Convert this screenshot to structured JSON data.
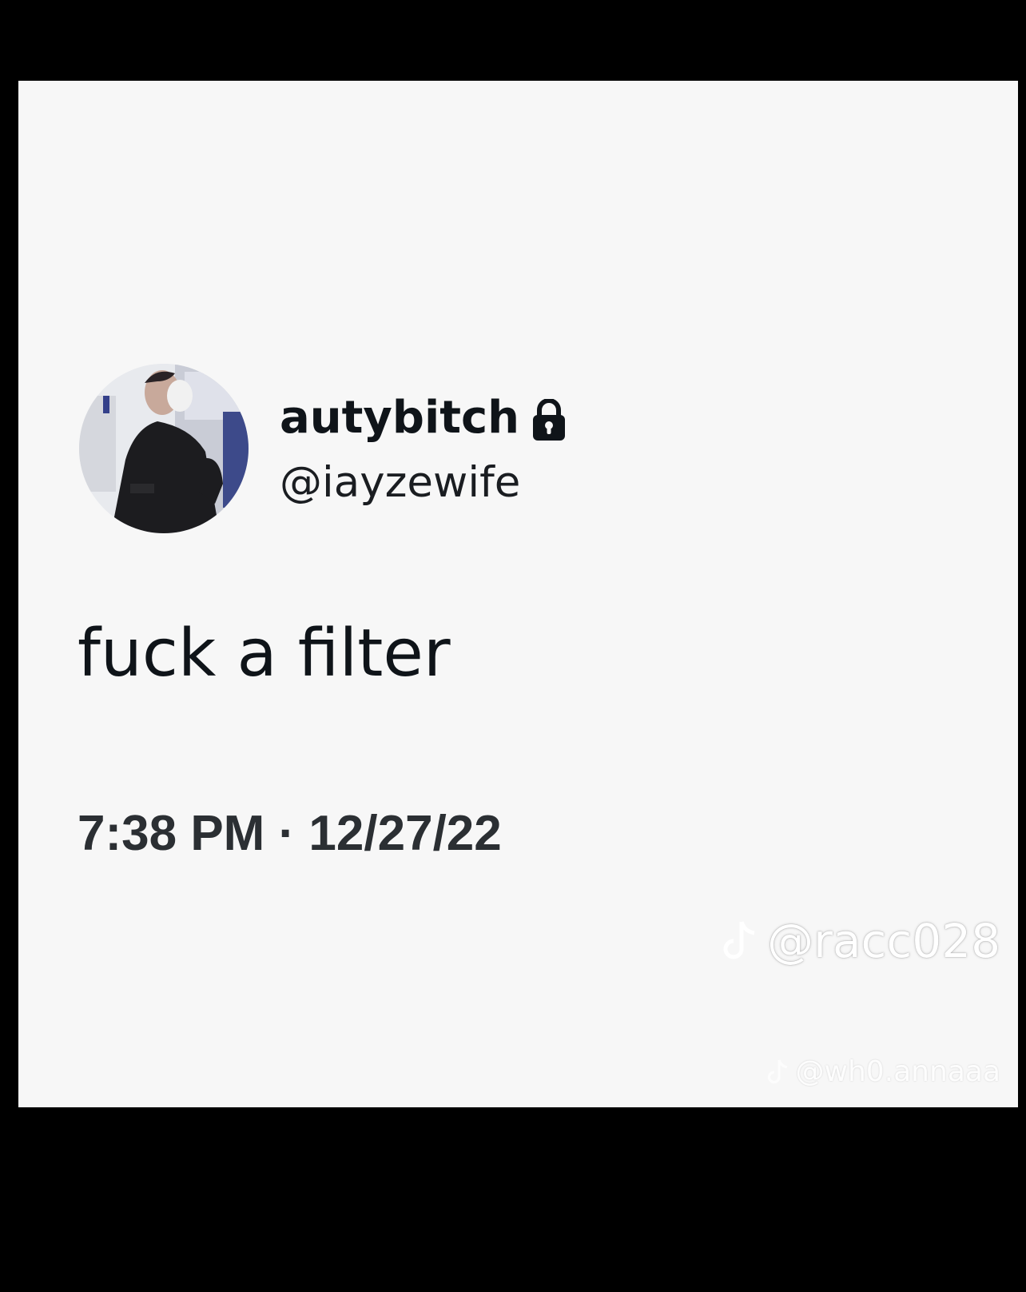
{
  "tweet": {
    "display_name": "autybitch",
    "protected_icon": "lock-icon",
    "handle": "@iayzewife",
    "avatar_icon": "profile-photo",
    "text": "fuck a filter",
    "timestamp": "7:38 PM · 12/27/22"
  },
  "watermarks": [
    {
      "icon": "tiktok-icon",
      "text": "@racc028"
    },
    {
      "icon": "tiktok-icon",
      "text": "@wh0.annaaa"
    }
  ],
  "colors": {
    "background": "#000000",
    "card": "#f7f7f7",
    "text_primary": "#0f1419",
    "watermark": "#ffffff"
  }
}
